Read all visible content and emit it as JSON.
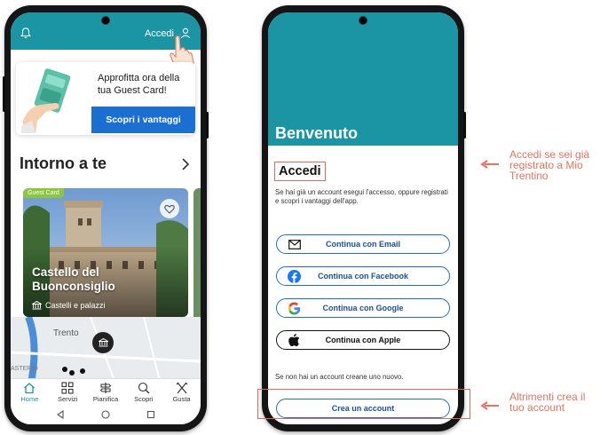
{
  "left_phone": {
    "header": {
      "login_label": "Accedi"
    },
    "promo": {
      "text_line1": "Approfitta ora della",
      "text_line2": "tua Guest Card!",
      "button_label": "Scopri i vantaggi"
    },
    "section": {
      "title": "Intorno a te"
    },
    "card": {
      "badge": "Guest Card",
      "title_line1": "Castello del",
      "title_line2": "Buonconsiglio",
      "subtitle": "Castelli e palazzi"
    },
    "map": {
      "city_label": "Trento",
      "street_label": "ASTERIO"
    },
    "tabs": [
      {
        "label": "Home",
        "icon": "home-icon"
      },
      {
        "label": "Servizi",
        "icon": "grid-icon"
      },
      {
        "label": "Pianifica",
        "icon": "signpost-icon"
      },
      {
        "label": "Scopri",
        "icon": "discover-icon"
      },
      {
        "label": "Gusta",
        "icon": "utensils-icon"
      }
    ]
  },
  "right_phone": {
    "welcome_title": "Benvenuto",
    "section_title": "Accedi",
    "description": "Se hai già un account esegui l'accesso, oppure registrati e scopri i vantaggi dell'app.",
    "buttons": {
      "email": "Continua con Email",
      "facebook": "Continua con Facebook",
      "google": "Continua con Google",
      "apple": "Continua con Apple"
    },
    "no_account_text": "Se non hai un account creane uno nuovo.",
    "create_account_label": "Crea un account"
  },
  "annotations": {
    "login_hint": [
      "Accedi se sei già",
      "registrato a Mio",
      "Trentino"
    ],
    "create_hint": [
      "Altrimenti crea il",
      "tuo account"
    ]
  },
  "colors": {
    "teal": "#1b95a3",
    "blue": "#1a6fd1",
    "annotation": "#e8735f",
    "badge_green": "#8cc63f"
  }
}
